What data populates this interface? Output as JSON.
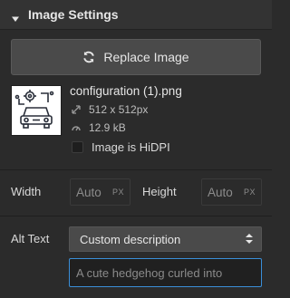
{
  "header": {
    "title": "Image Settings",
    "caret_icon": "caret-down-icon"
  },
  "replace_button": {
    "label": "Replace Image",
    "icon": "refresh-icon"
  },
  "file": {
    "name": "configuration (1).png",
    "dimensions": "512 x 512px",
    "size": "12.9 kB",
    "hidpi_label": "Image is HiDPI",
    "hidpi_checked": false
  },
  "size_fields": {
    "width_label": "Width",
    "width_value": "Auto",
    "width_unit": "PX",
    "height_label": "Height",
    "height_value": "Auto",
    "height_unit": "PX"
  },
  "alt_text": {
    "label": "Alt Text",
    "select_value": "Custom description",
    "input_text": "A cute hedgehog curled into"
  },
  "colors": {
    "background": "#2b2b2b",
    "header_bg": "#333333",
    "button_bg": "#4a4a4a",
    "focus_border": "#3a8fd9"
  }
}
